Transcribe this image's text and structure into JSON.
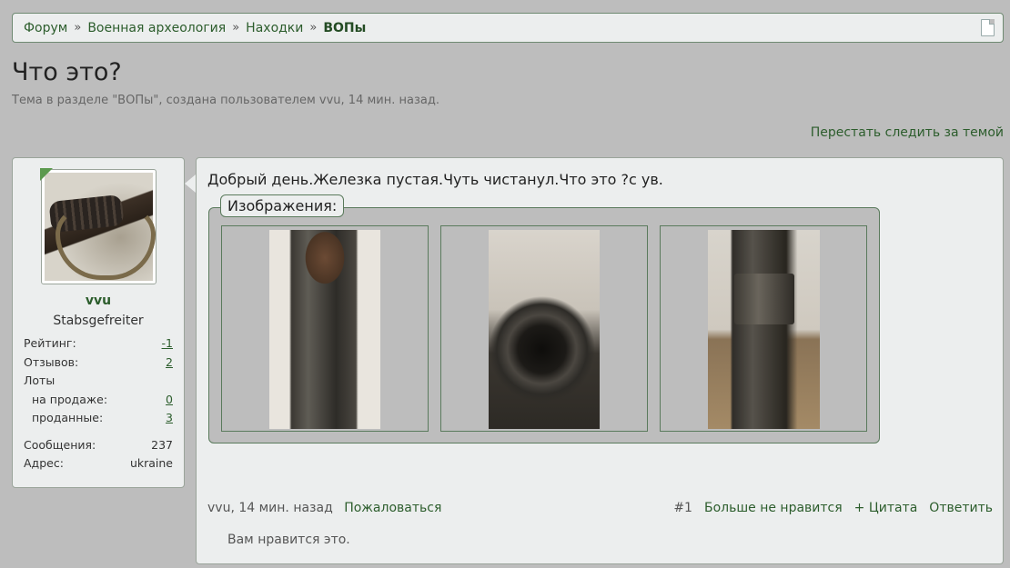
{
  "breadcrumb": {
    "items": [
      "Форум",
      "Военная археология",
      "Находки"
    ],
    "current": "ВОПы",
    "separator": "»"
  },
  "thread": {
    "title": "Что это?",
    "subtitle": "Тема в разделе \"ВОПы\", создана пользователем vvu, 14 мин. назад.",
    "unwatch_label": "Перестать следить за темой"
  },
  "user": {
    "name": "vvu",
    "title": "Stabsgefreiter",
    "stats": {
      "rating_label": "Рейтинг:",
      "rating_value": "-1",
      "reviews_label": "Отзывов:",
      "reviews_value": "2",
      "lots_label": "Лоты",
      "on_sale_label": "на продаже:",
      "on_sale_value": "0",
      "sold_label": "проданные:",
      "sold_value": "3",
      "messages_label": "Сообщения:",
      "messages_value": "237",
      "address_label": "Адрес:",
      "address_value": "ukraine"
    }
  },
  "post": {
    "text": "Добрый день.Железка пустая.Чуть чистанул.Что это ?с ув.",
    "attachments_label": "Изображения:",
    "author_time": "vvu, 14 мин. назад",
    "report_label": "Пожаловаться",
    "number": "#1",
    "unlike_label": "Больше не нравится",
    "quote_label": "+ Цитата",
    "reply_label": "Ответить",
    "likes_text": "Вам нравится это."
  },
  "colors": {
    "background": "#bdbdbd",
    "panel": "#eceeee",
    "link": "#2c5d2c",
    "border": "#5a7a5c"
  }
}
